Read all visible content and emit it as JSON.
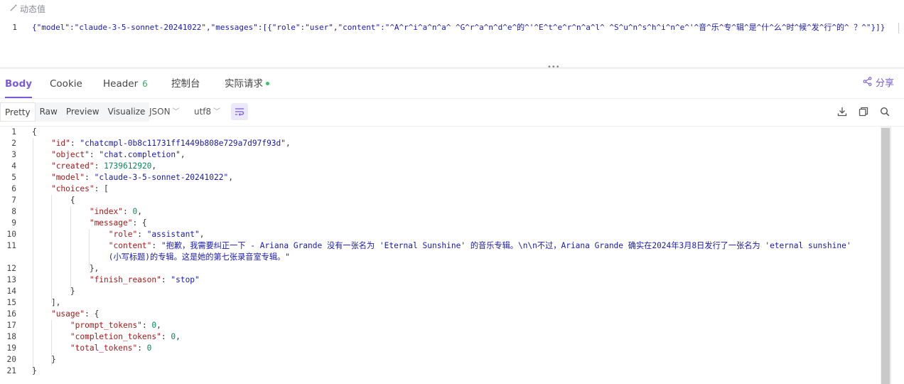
{
  "dynamic_label": "动态值",
  "request": {
    "line_number": "1",
    "body": "{\"model\":\"claude-3-5-sonnet-20241022\",\"messages\":[{\"role\":\"user\",\"content\":\"^A^r^i^a^n^a^ ^G^r^a^n^d^e^的^'^E^t^e^r^n^a^l^ ^S^u^n^s^h^i^n^e^'^音^乐^专^辑^是^什^么^时^候^发^行^的^ ？^\"}]}"
  },
  "tabs": [
    {
      "label": "Body",
      "active": true
    },
    {
      "label": "Cookie"
    },
    {
      "label": "Header",
      "badge": "6"
    },
    {
      "label": "控制台"
    },
    {
      "label": "实际请求"
    }
  ],
  "share_label": "分享",
  "view_modes": [
    "Pretty",
    "Raw",
    "Preview",
    "Visualize"
  ],
  "format_select": "JSON",
  "encoding_select": "utf8",
  "response": {
    "line_numbers": [
      "1",
      "2",
      "3",
      "4",
      "5",
      "6",
      "7",
      "8",
      "9",
      "10",
      "11",
      "",
      "12",
      "13",
      "14",
      "15",
      "16",
      "17",
      "18",
      "19",
      "20",
      "21"
    ],
    "id": "\"chatcmpl-0b8c11731ff1449b808e729a7d97f93d\"",
    "object": "\"chat.completion\"",
    "created": "1739612920",
    "model": "\"claude-3-5-sonnet-20241022\"",
    "index": "0",
    "role": "\"assistant\"",
    "content_1": "\"抱歉，我需要纠正一下 - Ariana Grande 没有一张名为 'Eternal Sunshine' 的音乐专辑。\\n\\n不过，Ariana Grande 确实在2024年3月8日发行了一张名为 'eternal sunshine'",
    "content_2": "(小写标题)的专辑。这是她的第七张录音室专辑。\"",
    "finish_reason": "\"stop\"",
    "prompt_tokens": "0",
    "completion_tokens": "0",
    "total_tokens": "0"
  },
  "colors": {
    "accent": "#7a5ad8",
    "key": "#a11a1a",
    "string": "#1a1aa6",
    "number": "#098658"
  },
  "icons": [
    "magic-wand-icon",
    "share-icon",
    "wrap-lines-icon",
    "download-icon",
    "copy-icon",
    "search-icon"
  ]
}
